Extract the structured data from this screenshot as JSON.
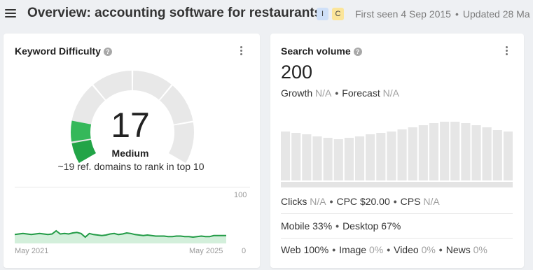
{
  "header": {
    "title": "Overview: accounting software for restaurants",
    "intent_badges": [
      "I",
      "C"
    ],
    "first_seen": "First seen 4 Sep 2015",
    "updated": "Updated 28 Ma"
  },
  "keyword_difficulty": {
    "title": "Keyword Difficulty",
    "help_glyph": "?",
    "value": "17",
    "level": "Medium",
    "description": "~19 ref. domains to rank in top 10",
    "gauge_fill_fraction": 0.17,
    "colors": {
      "fill": "#22a447",
      "fill_light": "#35b85a",
      "track": "#e8e8e8"
    },
    "trend": {
      "x_start": "May 2021",
      "x_end": "May 2025",
      "y_max": "100",
      "y_min": "0",
      "values": [
        17,
        18,
        19,
        18,
        17,
        18,
        19,
        18,
        17,
        18,
        24,
        18,
        19,
        18,
        20,
        21,
        19,
        12,
        19,
        17,
        16,
        15,
        16,
        18,
        19,
        17,
        18,
        20,
        19,
        17,
        16,
        15,
        16,
        15,
        14,
        14,
        14,
        13,
        13,
        14,
        14,
        13,
        13,
        12,
        13,
        14,
        13,
        13,
        15,
        15,
        15,
        15
      ]
    }
  },
  "search_volume": {
    "title": "Search volume",
    "help_glyph": "?",
    "value": "200",
    "growth_label": "Growth",
    "growth_value": "N/A",
    "forecast_label": "Forecast",
    "forecast_value": "N/A",
    "bars": [
      70,
      68,
      66,
      63,
      61,
      59,
      61,
      63,
      66,
      68,
      70,
      73,
      76,
      79,
      82,
      84,
      84,
      82,
      79,
      76,
      72,
      70
    ],
    "clicks_label": "Clicks",
    "clicks_value": "N/A",
    "cpc_label": "CPC",
    "cpc_value": "$20.00",
    "cps_label": "CPS",
    "cps_value": "N/A",
    "mobile": "Mobile 33%",
    "desktop": "Desktop 67%",
    "web_label": "Web",
    "web_value": "100%",
    "image_label": "Image",
    "image_value": "0%",
    "video_label": "Video",
    "video_value": "0%",
    "news_label": "News",
    "news_value": "0%"
  }
}
